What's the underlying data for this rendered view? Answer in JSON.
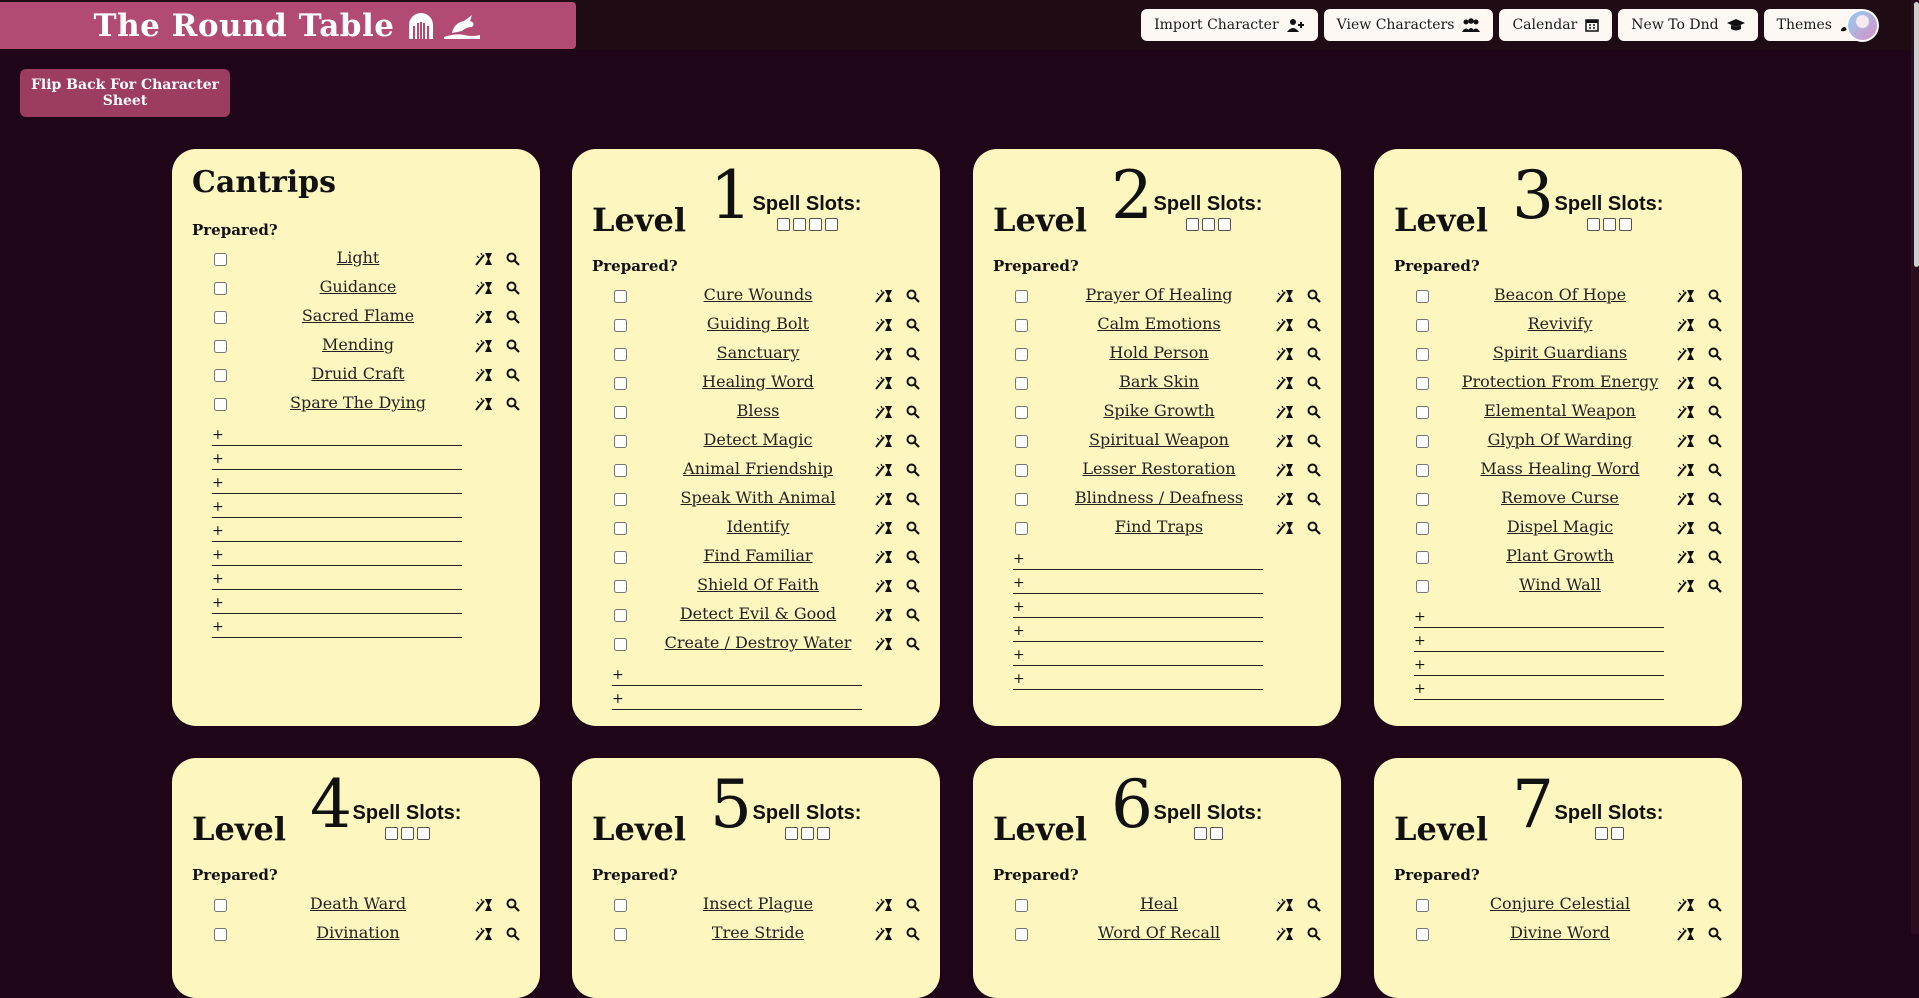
{
  "brand": {
    "title": "The Round Table"
  },
  "nav": [
    {
      "label": "Import Character",
      "icon": "user-plus-icon"
    },
    {
      "label": "View Characters",
      "icon": "users-icon"
    },
    {
      "label": "Calendar",
      "icon": "calendar-icon"
    },
    {
      "label": "New To Dnd",
      "icon": "graduation-cap-icon"
    },
    {
      "label": "Themes",
      "icon": "paintbrush-icon"
    }
  ],
  "flip_button": "Flip Back For Character Sheet",
  "prepared_label": "Prepared?",
  "spell_slots_label": "Spell Slots:",
  "level_word": "Level",
  "colors": {
    "page_bg": "#1f0518",
    "card_bg": "#fdf7bf",
    "brand": "#b14b74",
    "flip": "#9c3c61"
  },
  "cards": [
    {
      "title": "Cantrips",
      "spells": [
        "Light",
        "Guidance",
        "Sacred Flame",
        "Mending",
        "Druid Craft",
        "Spare The Dying"
      ],
      "blank_rows": 9,
      "add_symbol": "+"
    },
    {
      "level": "1",
      "slots": 4,
      "spells": [
        "Cure Wounds",
        "Guiding Bolt",
        "Sanctuary",
        "Healing Word",
        "Bless",
        "Detect Magic",
        "Animal Friendship",
        "Speak With Animal",
        "Identify",
        "Find Familiar",
        "Shield Of Faith",
        "Detect Evil & Good",
        "Create / Destroy Water"
      ],
      "blank_rows": 2,
      "add_symbol": "+"
    },
    {
      "level": "2",
      "slots": 3,
      "spells": [
        "Prayer Of Healing",
        "Calm Emotions",
        "Hold Person",
        "Bark Skin",
        "Spike Growth",
        "Spiritual Weapon",
        "Lesser Restoration",
        "Blindness / Deafness",
        "Find Traps"
      ],
      "blank_rows": 6,
      "add_symbol": "+"
    },
    {
      "level": "3",
      "slots": 3,
      "spells": [
        "Beacon Of Hope",
        "Revivify",
        "Spirit Guardians",
        "Protection From Energy",
        "Elemental Weapon",
        "Glyph Of Warding",
        "Mass Healing Word",
        "Remove Curse",
        "Dispel Magic",
        "Plant Growth",
        "Wind Wall"
      ],
      "blank_rows": 4,
      "add_symbol": "+"
    },
    {
      "level": "4",
      "slots": 3,
      "spells": [
        "Death Ward",
        "Divination"
      ]
    },
    {
      "level": "5",
      "slots": 3,
      "spells": [
        "Insect Plague",
        "Tree Stride"
      ]
    },
    {
      "level": "6",
      "slots": 2,
      "spells": [
        "Heal",
        "Word Of Recall"
      ]
    },
    {
      "level": "7",
      "slots": 2,
      "spells": [
        "Conjure Celestial",
        "Divine Word"
      ]
    }
  ]
}
